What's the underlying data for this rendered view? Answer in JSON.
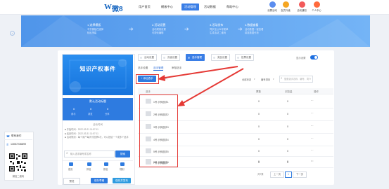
{
  "header": {
    "logo_mark": "W",
    "logo_text": "微8",
    "nav": [
      "用户首页",
      "模板中心",
      "活动管理",
      "活动数据",
      "帮助中心"
    ],
    "active_nav_index": 2,
    "tools": [
      {
        "label": "设置活动",
        "icon": "gear-icon",
        "color": "#5b8def"
      },
      {
        "label": "会员升级",
        "icon": "crown-icon",
        "color": "#f5a623"
      },
      {
        "label": "活动通知",
        "icon": "bell-icon",
        "color": "#f25a5a"
      },
      {
        "label": "个人中心",
        "icon": "user-icon",
        "color": "#ff6a3c"
      }
    ]
  },
  "banner": {
    "steps": [
      {
        "num": "1.选择模板",
        "desc": [
          "丰富模板任选择",
          "轻松搭建"
        ]
      },
      {
        "num": "2.活动设置",
        "desc": [
          "活动规则设置",
          "可视化编辑"
        ]
      },
      {
        "num": "3.活动发布",
        "desc": [
          "同步至公众号菜单",
          "生成活动二维码"
        ]
      },
      {
        "num": "4.数据查看",
        "desc": [
          "活动数据一键查看",
          "精准数据分析"
        ]
      }
    ]
  },
  "preview": {
    "poster_title": "知识产权事件",
    "card_title": "默认活动标题",
    "stats": [
      {
        "value": "0",
        "label": "参与"
      },
      {
        "value": "0",
        "label": "浏览"
      },
      {
        "value": "0",
        "label": "分享"
      }
    ],
    "section_title": "活动时间",
    "info_lines": [
      "■ 开始时间：2022-03-21 11:57:11",
      "■ 结束时间：2022-03-31 11:57:11",
      "■ 活动规则：每个用户每天可投票5次，可以投给一个或多个选手"
    ],
    "search_placeholder": "输入选手编号或名称",
    "search_button": "搜索",
    "nav_items": [
      "首页",
      "排名",
      "报名",
      "规则"
    ],
    "bottom_buttons": [
      "预览",
      "保存草稿",
      "保存并发布"
    ]
  },
  "editor": {
    "tabs": [
      "活动设置",
      "页面设置",
      "选手管理",
      "奖品设置",
      "投票设置"
    ],
    "active_tab_index": 2,
    "toggle_label": "显示设置",
    "subtabs": [
      "选手设置",
      "选手管理",
      "审核选手"
    ],
    "active_subtab_index": 1,
    "add_button": "+ 添加选手",
    "import_label": "导入",
    "filter_select": "全部状态",
    "sort_select": "编号排序",
    "search_placeholder": "搜索选手名称、编号、简介",
    "columns": [
      "选手",
      "票数",
      "浏览量",
      "操作"
    ],
    "rows": [
      {
        "name": "1号 示例选手1",
        "votes": "0",
        "views": "0",
        "action": "···"
      },
      {
        "name": "2号 示例选手2",
        "votes": "0",
        "views": "0",
        "action": "···"
      },
      {
        "name": "3号 示例选手3",
        "votes": "0",
        "views": "0",
        "action": "···"
      },
      {
        "name": "4号 示例选手4",
        "votes": "0",
        "views": "0",
        "action": "···"
      },
      {
        "name": "5号 示例选手5",
        "votes": "0",
        "views": "0",
        "action": "···"
      },
      {
        "name": "6号 示例选手6",
        "votes": "0",
        "views": "0",
        "action": "···"
      },
      {
        "name": "7号 示例选手7",
        "votes": "0",
        "views": "0",
        "action": "···"
      }
    ],
    "pager": {
      "total": "共7条",
      "prev": "上一页",
      "page": "1",
      "next": "下一页"
    }
  },
  "side": {
    "title": "联系我们",
    "phone": "13057236899",
    "qr_caption": "微信二维码"
  },
  "colors": {
    "primary": "#3a7ee6",
    "highlight": "#e53935",
    "banner": "#5da3f2"
  }
}
